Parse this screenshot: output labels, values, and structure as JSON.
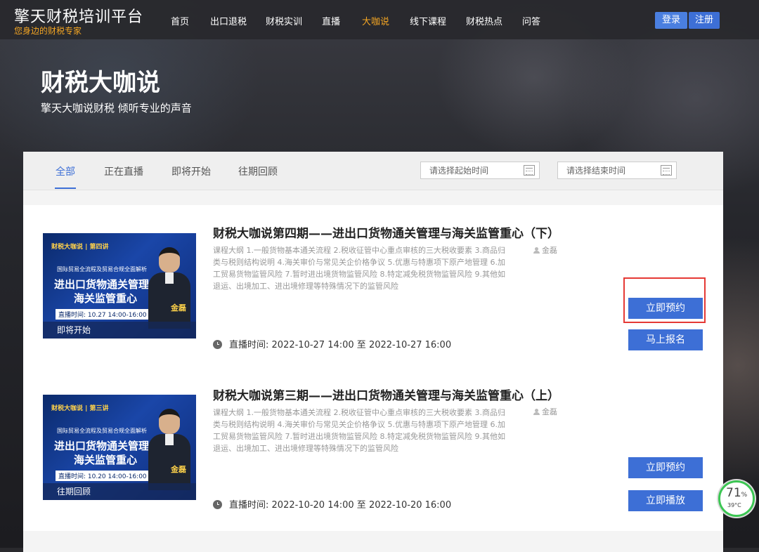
{
  "site": {
    "title": "擎天财税培训平台",
    "subtitle": "您身边的财税专家"
  },
  "nav": [
    {
      "label": "首页"
    },
    {
      "label": "出口退税"
    },
    {
      "label": "财税实训"
    },
    {
      "label": "直播"
    },
    {
      "label": "大咖说",
      "active": true
    },
    {
      "label": "线下课程"
    },
    {
      "label": "财税热点"
    },
    {
      "label": "问答"
    }
  ],
  "auth": {
    "login": "登录",
    "register": "注册"
  },
  "hero": {
    "title": "财税大咖说",
    "subtitle": "擎天大咖说财税  倾听专业的声音"
  },
  "tabs": [
    {
      "label": "全部",
      "active": true
    },
    {
      "label": "正在直播"
    },
    {
      "label": "即将开始"
    },
    {
      "label": "往期回顾"
    }
  ],
  "filters": {
    "start_placeholder": "请选择起始时间",
    "end_placeholder": "请选择结束时间"
  },
  "courses": [
    {
      "title": "财税大咖说第四期——进出口货物通关管理与海关监管重心（下）",
      "description": "课程大纲 1.一般货物基本通关流程 2.税收征管中心重点审核的三大税收要素 3.商品归类与税则结构说明 4.海关审价与常见关企价格争议 5.优惠与特惠项下原产地管理 6.加工贸易货物监管风险 7.暂时进出境货物监管风险 8.特定减免税货物监管风险 9.其他如退运、出境加工、进出境修理等特殊情况下的监管风险",
      "author": "金磊",
      "time_label": "直播时间:",
      "time_value": "2022-10-27 14:00 至 2022-10-27 16:00",
      "status": "即将开始",
      "thumb": {
        "brand": "财税大咖说 | 第四讲",
        "line1": "国际贸易全流程及贸易合规全面解析",
        "line2": "进出口货物通关管理与",
        "line3": "海关监管重心",
        "time": "直播时间: 10.27 14:00-16:00",
        "name": "金磊"
      },
      "buttons": [
        "立即预约",
        "马上报名"
      ]
    },
    {
      "title": "财税大咖说第三期——进出口货物通关管理与海关监管重心（上）",
      "description": "课程大纲 1.一般货物基本通关流程 2.税收征管中心重点审核的三大税收要素 3.商品归类与税则结构说明 4.海关审价与常见关企价格争议 5.优惠与特惠项下原产地管理 6.加工贸易货物监管风险 7.暂时进出境货物监管风险 8.特定减免税货物监管风险 9.其他如退运、出境加工、进出境修理等特殊情况下的监管风险",
      "author": "金磊",
      "time_label": "直播时间:",
      "time_value": "2022-10-20 14:00 至 2022-10-20 16:00",
      "status": "往期回顾",
      "thumb": {
        "brand": "财税大咖说 | 第三讲",
        "line1": "国际贸易全流程及贸易合规全面解析",
        "line2": "进出口货物通关管理与",
        "line3": "海关监管重心",
        "time": "直播时间: 10.20 14:00-16:00",
        "name": "金磊"
      },
      "buttons": [
        "立即预约",
        "立即播放"
      ]
    }
  ],
  "widget": {
    "percent": "71",
    "percent_sign": "%",
    "temp": "39°C"
  }
}
